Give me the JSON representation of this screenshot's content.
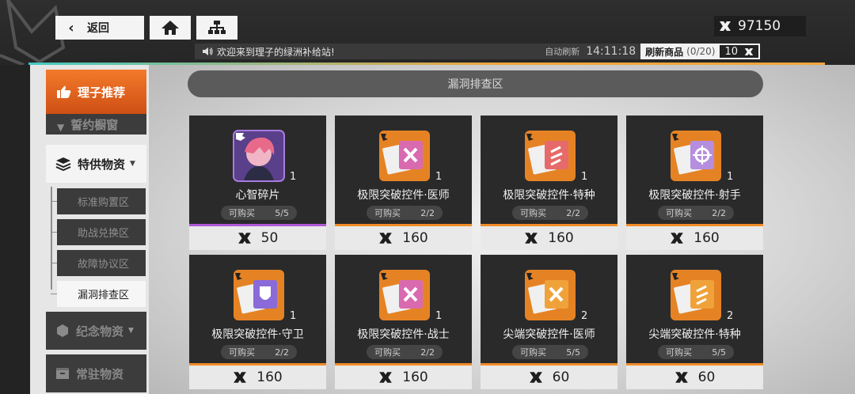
{
  "header": {
    "back_label": "返回",
    "home_icon": "home-icon",
    "sitemap_icon": "sitemap-icon",
    "currency_amount": "97150"
  },
  "marquee": {
    "message": "欢迎来到理子的绿洲补给站!",
    "auto_refresh_label": "自动刷新",
    "auto_refresh_time": "14:11:18",
    "refresh_label": "刷新商品",
    "refresh_count": "(0/20)",
    "refresh_cost": "10"
  },
  "sidebar": {
    "recommend": "理子推荐",
    "faded_item": "誓约橱窗",
    "special": "特供物资",
    "sub_items": [
      "标准购置区",
      "助战兑换区",
      "故障协议区",
      "漏洞排查区"
    ],
    "memorial": "纪念物资",
    "regular": "常驻物资"
  },
  "section_title": "漏洞排查区",
  "cards": [
    {
      "name": "心智碎片",
      "qty": "1",
      "stock_label": "可购买",
      "stock": "5/5",
      "price": "50"
    },
    {
      "name": "极限突破控件·医师",
      "qty": "1",
      "stock_label": "可购买",
      "stock": "2/2",
      "price": "160"
    },
    {
      "name": "极限突破控件·特种",
      "qty": "1",
      "stock_label": "可购买",
      "stock": "2/2",
      "price": "160"
    },
    {
      "name": "极限突破控件·射手",
      "qty": "1",
      "stock_label": "可购买",
      "stock": "2/2",
      "price": "160"
    },
    {
      "name": "极限突破控件·守卫",
      "qty": "1",
      "stock_label": "可购买",
      "stock": "2/2",
      "price": "160"
    },
    {
      "name": "极限突破控件·战士",
      "qty": "1",
      "stock_label": "可购买",
      "stock": "2/2",
      "price": "160"
    },
    {
      "name": "尖端突破控件·医师",
      "qty": "2",
      "stock_label": "可购买",
      "stock": "5/5",
      "price": "60"
    },
    {
      "name": "尖端突破控件·特种",
      "qty": "2",
      "stock_label": "可购买",
      "stock": "5/5",
      "price": "60"
    }
  ],
  "colors": {
    "accent_orange": "#f28c28",
    "accent_purple": "#b058d8",
    "accent_teal": "#43c9c2"
  }
}
